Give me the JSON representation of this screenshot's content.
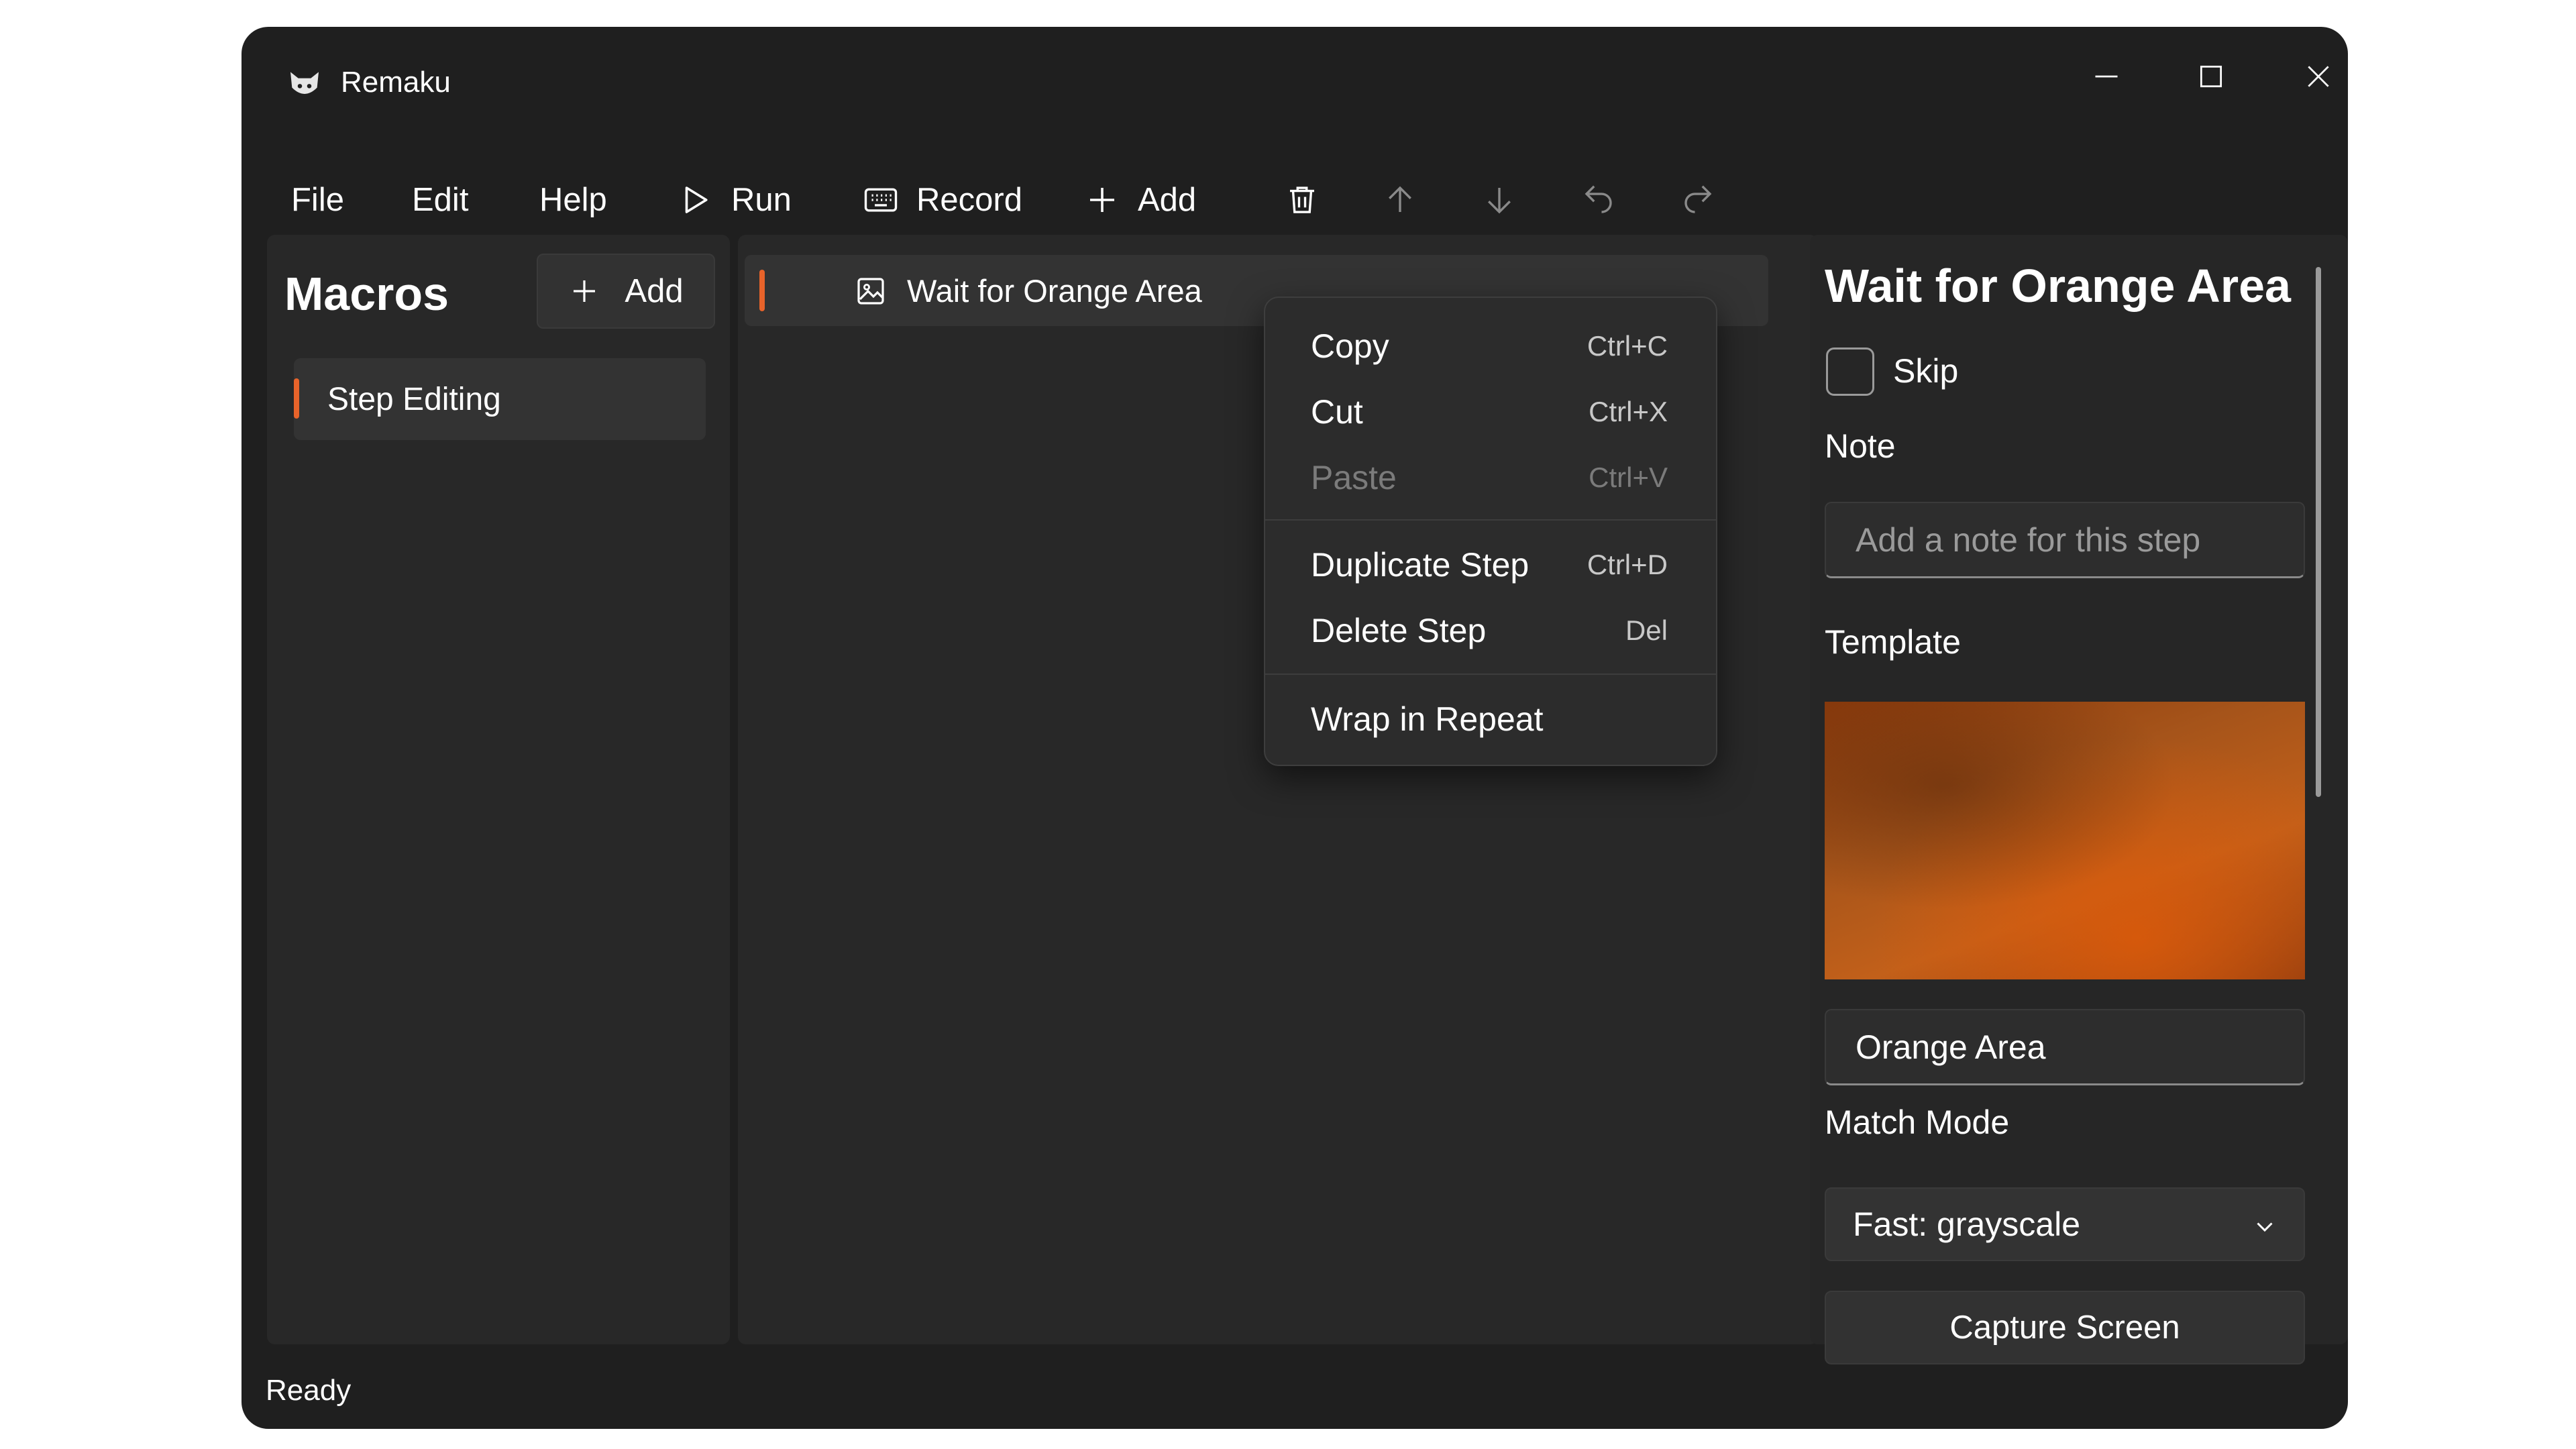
{
  "window": {
    "title": "Remaku"
  },
  "menubar": {
    "file": "File",
    "edit": "Edit",
    "help": "Help"
  },
  "toolbar": {
    "run": "Run",
    "record": "Record",
    "add": "Add"
  },
  "macros": {
    "title": "Macros",
    "add_label": "Add",
    "items": [
      {
        "label": "Step Editing",
        "selected": true
      }
    ]
  },
  "steps": [
    {
      "label": "Wait for Orange Area",
      "icon": "image-icon"
    }
  ],
  "context_menu": {
    "items": [
      {
        "label": "Copy",
        "shortcut": "Ctrl+C",
        "enabled": true
      },
      {
        "label": "Cut",
        "shortcut": "Ctrl+X",
        "enabled": true
      },
      {
        "label": "Paste",
        "shortcut": "Ctrl+V",
        "enabled": false
      },
      {
        "label": "Duplicate Step",
        "shortcut": "Ctrl+D",
        "enabled": true
      },
      {
        "label": "Delete Step",
        "shortcut": "Del",
        "enabled": true
      },
      {
        "label": "Wrap in Repeat",
        "shortcut": "",
        "enabled": true
      }
    ]
  },
  "properties": {
    "title": "Wait for Orange Area",
    "skip_label": "Skip",
    "skip_checked": false,
    "note_label": "Note",
    "note_placeholder": "Add a note for this step",
    "template_label": "Template",
    "template_name": "Orange Area",
    "match_mode_label": "Match Mode",
    "match_mode_value": "Fast: grayscale",
    "capture_label": "Capture Screen"
  },
  "status": {
    "text": "Ready"
  },
  "colors": {
    "accent": "#e8632a",
    "background": "#1f1f1f",
    "pane": "#282828"
  }
}
